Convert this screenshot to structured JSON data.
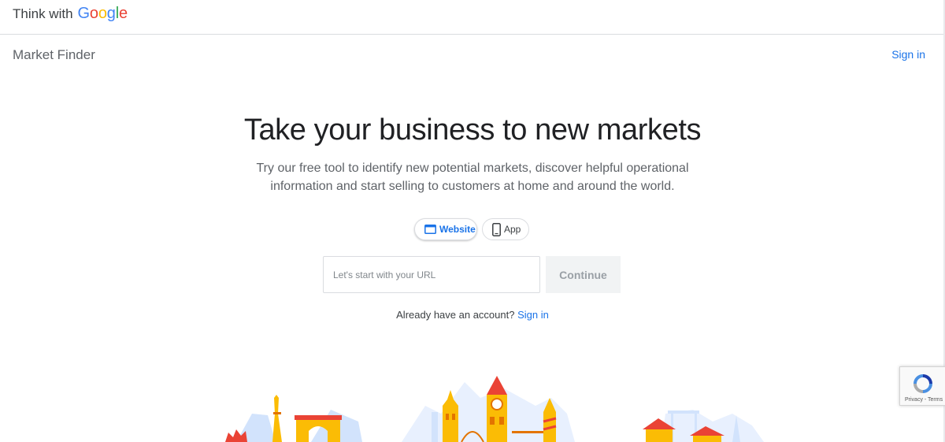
{
  "header": {
    "brand_prefix": "Think with",
    "brand_google_letters": [
      "G",
      "o",
      "o",
      "g",
      "l",
      "e"
    ]
  },
  "subheader": {
    "product_name": "Market Finder",
    "sign_in": "Sign in"
  },
  "hero": {
    "headline": "Take your business to new markets",
    "subtitle": "Try our free tool to identify new potential markets, discover helpful operational information and start selling to customers at home and around the world."
  },
  "mode_toggle": {
    "selected": "Website",
    "options": [
      {
        "label": "Website",
        "icon": "browser-window-icon"
      },
      {
        "label": "App",
        "icon": "phone-icon"
      }
    ]
  },
  "url_form": {
    "placeholder": "Let's start with your URL",
    "value": "",
    "continue_label": "Continue"
  },
  "account_prompt": {
    "text": "Already have an account?",
    "link": "Sign in"
  },
  "recaptcha": {
    "links": "Privacy - Terms"
  },
  "colors": {
    "accent_blue": "#1a73e8",
    "google_blue": "#4285f4",
    "google_red": "#ea4335",
    "google_yellow": "#fbbc05",
    "google_green": "#34a853"
  }
}
